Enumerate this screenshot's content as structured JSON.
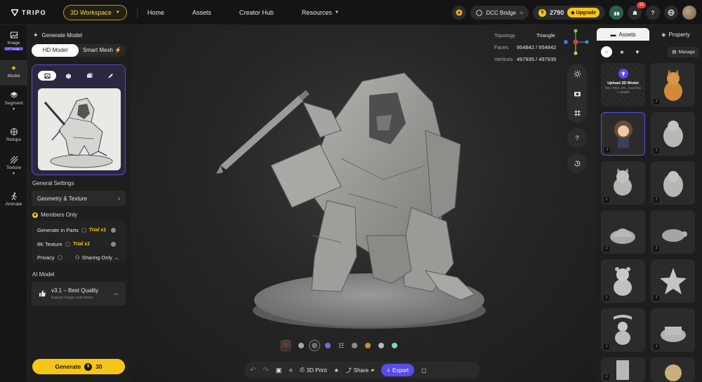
{
  "topnav": {
    "logo_text": "TRIPO",
    "workspace": "3D Workspace",
    "links": [
      "Home",
      "Assets",
      "Creator Hub",
      "Resources"
    ],
    "dcc_bridge": "DCC Bridge",
    "credits": "2790",
    "upgrade": "Upgrade",
    "notification_count": "13"
  },
  "rail": {
    "items": [
      {
        "label": "Image",
        "tag": "GPT Image 2"
      },
      {
        "label": "Model"
      },
      {
        "label": "Segment"
      },
      {
        "label": "Retopo"
      },
      {
        "label": "Texture"
      },
      {
        "label": "Animate"
      }
    ]
  },
  "panel": {
    "header": "Generate Model",
    "modes": [
      "HD Model",
      "Smart Mesh"
    ],
    "general_settings": "General Settings",
    "geometry_texture": "Geometry & Texture",
    "members_only": "Members Only",
    "generate_in_parts": "Generate in Parts",
    "texture_8k": "8K Texture",
    "trial": "Trial x1",
    "privacy": "Privacy",
    "privacy_value": "Sharing Only",
    "ai_model_label": "AI Model",
    "ai_model_name": "v3.1 – Best Quality",
    "ai_model_hint": "Expect longer wait times",
    "generate_label": "Generate",
    "generate_cost": "30"
  },
  "viewport": {
    "topology_key": "Topology",
    "topology_val": "Triangle",
    "faces_key": "Faces",
    "faces_val": "954842 / 954842",
    "vertices_key": "Vertices",
    "vertices_val": "497935 / 497935",
    "bottom": {
      "print_label": "3D Print",
      "share_label": "Share",
      "export_label": "Export"
    },
    "material_colors": [
      "#a8a8a8",
      "#6e6e6e",
      "#7a6ad8",
      "#8d8d8d",
      "#d9892b",
      "#b8b8b8",
      "#7fd6cf"
    ]
  },
  "rpanel": {
    "tab_assets": "Assets",
    "tab_property": "Property",
    "manage": "Manage",
    "upload_title": "Upload 3D Model",
    "upload_sub": "OBJ, FBX, STL, GLB files < 150MB"
  },
  "colors": {
    "accent": "#f5c518",
    "purple": "#5b4bea"
  }
}
